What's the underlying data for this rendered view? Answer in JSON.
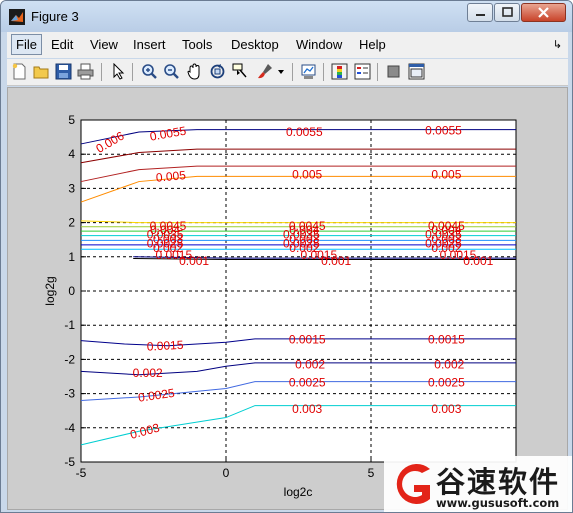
{
  "window": {
    "title": "Figure 3"
  },
  "menu": {
    "items": [
      {
        "label": "File"
      },
      {
        "label": "Edit"
      },
      {
        "label": "View"
      },
      {
        "label": "Insert"
      },
      {
        "label": "Tools"
      },
      {
        "label": "Desktop"
      },
      {
        "label": "Window"
      },
      {
        "label": "Help"
      }
    ]
  },
  "toolbar": {
    "icons": [
      "new-figure-icon",
      "open-file-icon",
      "save-icon",
      "print-icon",
      "edit-plot-arrow-icon",
      "zoom-in-icon",
      "zoom-out-icon",
      "pan-hand-icon",
      "rotate-3d-icon",
      "data-cursor-icon",
      "brush-icon",
      "brush-dropdown-icon",
      "link-plot-icon",
      "colorbar-icon",
      "legend-icon",
      "hide-plot-tools-icon",
      "show-plot-tools-icon"
    ]
  },
  "chart_data": {
    "type": "line",
    "xlabel": "log2c",
    "ylabel": "log2g",
    "xlim": [
      -5,
      10
    ],
    "ylim": [
      -5,
      5
    ],
    "x_ticks": [
      "-5",
      "0",
      "5"
    ],
    "y_ticks": [
      "5",
      "4",
      "3",
      "2",
      "1",
      "0",
      "-1",
      "-2",
      "-3",
      "-4",
      "-5"
    ],
    "grid": true,
    "grid_style": "dashed",
    "series": [
      {
        "color": "#000080",
        "x": [
          -5,
          -3,
          -1,
          0,
          0.5,
          5,
          10
        ],
        "y": [
          4.3,
          4.65,
          4.72,
          4.72,
          4.72,
          4.72,
          4.72
        ]
      },
      {
        "color": "#8b0000",
        "x": [
          -5,
          -3,
          -1,
          0,
          5,
          10
        ],
        "y": [
          3.75,
          4.05,
          4.15,
          4.15,
          4.15,
          4.15
        ]
      },
      {
        "color": "#b22222",
        "x": [
          -5,
          -3,
          -1,
          0,
          5,
          10
        ],
        "y": [
          3.2,
          3.55,
          3.65,
          3.65,
          3.65,
          3.65
        ]
      },
      {
        "color": "#ff8c00",
        "x": [
          -5,
          -3,
          -1,
          0,
          5,
          10
        ],
        "y": [
          2.6,
          3.2,
          3.35,
          3.35,
          3.35,
          3.35
        ]
      },
      {
        "color": "#ffd700",
        "x": [
          -5,
          -3,
          0,
          5,
          10
        ],
        "y": [
          2.05,
          2.0,
          2.0,
          2.0,
          2.0
        ]
      },
      {
        "color": "#9acd32",
        "x": [
          -5,
          0,
          5,
          10
        ],
        "y": [
          1.88,
          1.88,
          1.88,
          1.88
        ]
      },
      {
        "color": "#32cd32",
        "x": [
          -5,
          0,
          5,
          10
        ],
        "y": [
          1.75,
          1.75,
          1.75,
          1.75
        ]
      },
      {
        "color": "#00ced1",
        "x": [
          -5,
          0,
          5,
          10
        ],
        "y": [
          1.62,
          1.62,
          1.62,
          1.62
        ]
      },
      {
        "color": "#1e90ff",
        "x": [
          -5,
          0,
          5,
          10
        ],
        "y": [
          1.48,
          1.48,
          1.48,
          1.48
        ]
      },
      {
        "color": "#0000cd",
        "x": [
          -5,
          0,
          5,
          10
        ],
        "y": [
          1.35,
          1.35,
          1.35,
          1.35
        ]
      },
      {
        "color": "#00bfff",
        "x": [
          -5,
          0,
          5,
          10
        ],
        "y": [
          1.22,
          1.22,
          1.22,
          1.22
        ]
      },
      {
        "color": "#000080",
        "x": [
          -3.2,
          0,
          5,
          10
        ],
        "y": [
          1.0,
          0.96,
          0.96,
          0.96
        ]
      },
      {
        "color": "#000000",
        "x": [
          -3.2,
          0,
          5,
          10
        ],
        "y": [
          0.95,
          0.92,
          0.92,
          0.92
        ]
      },
      {
        "color": "#00008b",
        "x": [
          -5,
          -3.5,
          -2,
          0,
          1,
          5,
          10
        ],
        "y": [
          -1.45,
          -1.55,
          -1.6,
          -1.5,
          -1.4,
          -1.4,
          -1.4
        ]
      },
      {
        "color": "#000080",
        "x": [
          -5,
          -3,
          -1,
          0,
          1,
          5,
          10
        ],
        "y": [
          -2.35,
          -2.45,
          -2.35,
          -2.2,
          -2.1,
          -2.1,
          -2.1
        ]
      },
      {
        "color": "#4169e1",
        "x": [
          -5,
          -3,
          0,
          1,
          5,
          10
        ],
        "y": [
          -3.2,
          -3.1,
          -2.85,
          -2.65,
          -2.65,
          -2.65
        ]
      },
      {
        "color": "#00ced1",
        "x": [
          -5,
          -3,
          0,
          1,
          5,
          10
        ],
        "y": [
          -4.5,
          -4.1,
          -3.7,
          -3.35,
          -3.35,
          -3.35
        ]
      }
    ],
    "contour_labels": [
      {
        "text": "0.006",
        "x": -4.0,
        "y": 4.35,
        "angle": -30
      },
      {
        "text": "0.0055",
        "x": -2.0,
        "y": 4.6,
        "angle": -10
      },
      {
        "text": "0.0055",
        "x": 2.7,
        "y": 4.65,
        "angle": 0
      },
      {
        "text": "0.0055",
        "x": 7.5,
        "y": 4.7,
        "angle": 0
      },
      {
        "text": "0.005",
        "x": -1.9,
        "y": 3.35,
        "angle": -5
      },
      {
        "text": "0.005",
        "x": 2.8,
        "y": 3.4,
        "angle": 0
      },
      {
        "text": "0.005",
        "x": 7.6,
        "y": 3.4,
        "angle": 0
      },
      {
        "text": "0.0045",
        "x": -2.0,
        "y": 1.9,
        "angle": 0
      },
      {
        "text": "0.004",
        "x": -2.1,
        "y": 1.78,
        "angle": 0
      },
      {
        "text": "0.0035",
        "x": -2.1,
        "y": 1.65,
        "angle": 0
      },
      {
        "text": "0.003",
        "x": -2.0,
        "y": 1.52,
        "angle": 0
      },
      {
        "text": "0.0025",
        "x": -2.1,
        "y": 1.39,
        "angle": 0
      },
      {
        "text": "0.002",
        "x": -2.0,
        "y": 1.26,
        "angle": 0
      },
      {
        "text": "0.0015",
        "x": -1.8,
        "y": 1.05,
        "angle": 0
      },
      {
        "text": "0.001",
        "x": -1.1,
        "y": 0.88,
        "angle": 0
      },
      {
        "text": "0.0045",
        "x": 2.8,
        "y": 1.9,
        "angle": 0
      },
      {
        "text": "0.004",
        "x": 2.7,
        "y": 1.78,
        "angle": 0
      },
      {
        "text": "0.0035",
        "x": 2.6,
        "y": 1.65,
        "angle": 0
      },
      {
        "text": "0.003",
        "x": 2.7,
        "y": 1.52,
        "angle": 0
      },
      {
        "text": "0.0025",
        "x": 2.6,
        "y": 1.39,
        "angle": 0
      },
      {
        "text": "0.002",
        "x": 2.7,
        "y": 1.26,
        "angle": 0
      },
      {
        "text": "0.0015",
        "x": 3.2,
        "y": 1.05,
        "angle": 0
      },
      {
        "text": "0.001",
        "x": 3.8,
        "y": 0.88,
        "angle": 0
      },
      {
        "text": "0.0045",
        "x": 7.6,
        "y": 1.9,
        "angle": 0
      },
      {
        "text": "0.004",
        "x": 7.6,
        "y": 1.78,
        "angle": 0
      },
      {
        "text": "0.0035",
        "x": 7.5,
        "y": 1.65,
        "angle": 0
      },
      {
        "text": "0.003",
        "x": 7.6,
        "y": 1.52,
        "angle": 0
      },
      {
        "text": "0.0025",
        "x": 7.5,
        "y": 1.39,
        "angle": 0
      },
      {
        "text": "0.002",
        "x": 7.6,
        "y": 1.26,
        "angle": 0
      },
      {
        "text": "0.0015",
        "x": 8.0,
        "y": 1.05,
        "angle": 0
      },
      {
        "text": "0.001",
        "x": 8.7,
        "y": 0.88,
        "angle": 0
      },
      {
        "text": "0.0015",
        "x": -2.1,
        "y": -1.6,
        "angle": -3
      },
      {
        "text": "0.0015",
        "x": 2.8,
        "y": -1.42,
        "angle": 0
      },
      {
        "text": "0.0015",
        "x": 7.6,
        "y": -1.42,
        "angle": 0
      },
      {
        "text": "0.002",
        "x": -2.7,
        "y": -2.4,
        "angle": 0
      },
      {
        "text": "0.002",
        "x": 2.9,
        "y": -2.15,
        "angle": 0
      },
      {
        "text": "0.002",
        "x": 7.7,
        "y": -2.15,
        "angle": 0
      },
      {
        "text": "0.0025",
        "x": -2.4,
        "y": -3.05,
        "angle": -8
      },
      {
        "text": "0.0025",
        "x": 2.8,
        "y": -2.68,
        "angle": 0
      },
      {
        "text": "0.0025",
        "x": 7.6,
        "y": -2.68,
        "angle": 0
      },
      {
        "text": "0.003",
        "x": -2.8,
        "y": -4.1,
        "angle": -15
      },
      {
        "text": "0.003",
        "x": 2.8,
        "y": -3.45,
        "angle": 0
      },
      {
        "text": "0.003",
        "x": 7.6,
        "y": -3.45,
        "angle": 0
      }
    ]
  },
  "watermark": {
    "title": "谷速软件",
    "url": "www.gususoft.com"
  }
}
